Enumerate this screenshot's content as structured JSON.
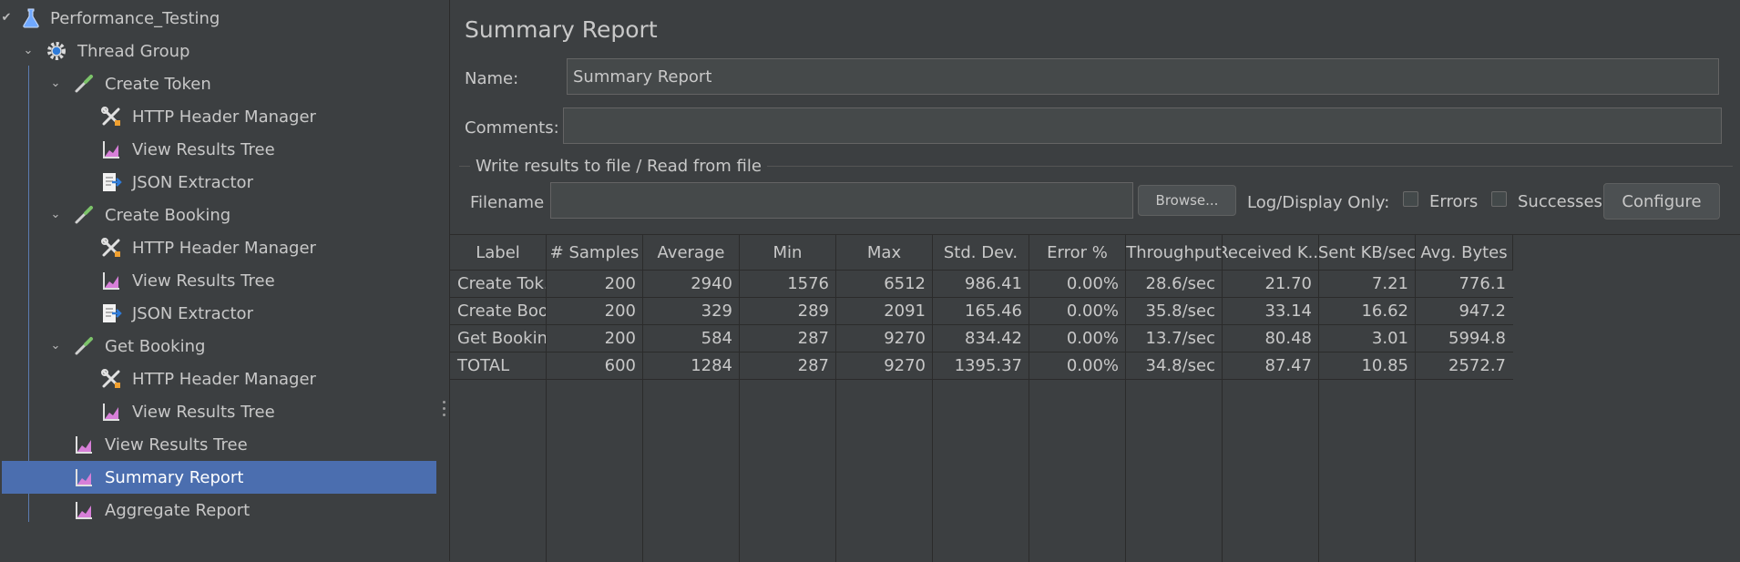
{
  "tree": {
    "items": [
      {
        "label": "Performance_Testing",
        "icon": "flask-icon"
      },
      {
        "label": "Thread Group",
        "icon": "gear-icon"
      },
      {
        "label": "Create Token",
        "icon": "pipette-icon"
      },
      {
        "label": "HTTP Header Manager",
        "icon": "tools-icon"
      },
      {
        "label": "View Results Tree",
        "icon": "graph-icon"
      },
      {
        "label": "JSON Extractor",
        "icon": "document-arrow-icon"
      },
      {
        "label": "Create Booking",
        "icon": "pipette-icon"
      },
      {
        "label": "HTTP Header Manager",
        "icon": "tools-icon"
      },
      {
        "label": "View Results Tree",
        "icon": "graph-icon"
      },
      {
        "label": "JSON Extractor",
        "icon": "document-arrow-icon"
      },
      {
        "label": "Get Booking",
        "icon": "pipette-icon"
      },
      {
        "label": "HTTP Header Manager",
        "icon": "tools-icon"
      },
      {
        "label": "View Results Tree",
        "icon": "graph-icon"
      },
      {
        "label": "View Results Tree",
        "icon": "graph-icon"
      },
      {
        "label": "Summary Report",
        "icon": "graph-icon"
      },
      {
        "label": "Aggregate Report",
        "icon": "graph-icon"
      }
    ],
    "selected": "Summary Report"
  },
  "panel": {
    "title": "Summary Report",
    "name_label": "Name:",
    "name_value": "Summary Report",
    "comments_label": "Comments:",
    "comments_value": "",
    "fieldset_title": "Write results to file / Read from file",
    "filename_label": "Filename",
    "filename_value": "",
    "browse_label": "Browse...",
    "log_display_label": "Log/Display Only:",
    "errors_label": "Errors",
    "successes_label": "Successes",
    "configure_label": "Configure"
  },
  "table": {
    "headers": [
      "Label",
      "# Samples",
      "Average",
      "Min",
      "Max",
      "Std. Dev.",
      "Error %",
      "Throughput",
      "Received K...",
      "Sent KB/sec",
      "Avg. Bytes"
    ],
    "rows": [
      [
        "Create Tok...",
        "200",
        "2940",
        "1576",
        "6512",
        "986.41",
        "0.00%",
        "28.6/sec",
        "21.70",
        "7.21",
        "776.1"
      ],
      [
        "Create Boo...",
        "200",
        "329",
        "289",
        "2091",
        "165.46",
        "0.00%",
        "35.8/sec",
        "33.14",
        "16.62",
        "947.2"
      ],
      [
        "Get Booking",
        "200",
        "584",
        "287",
        "9270",
        "834.42",
        "0.00%",
        "13.7/sec",
        "80.48",
        "3.01",
        "5994.8"
      ],
      [
        "TOTAL",
        "600",
        "1284",
        "287",
        "9270",
        "1395.37",
        "0.00%",
        "34.8/sec",
        "87.47",
        "10.85",
        "2572.7"
      ]
    ]
  },
  "colors": {
    "background": "#3c3f41",
    "selection": "#4b6eaf",
    "text": "#c8c8c8",
    "grid": "#2b2b2b"
  }
}
